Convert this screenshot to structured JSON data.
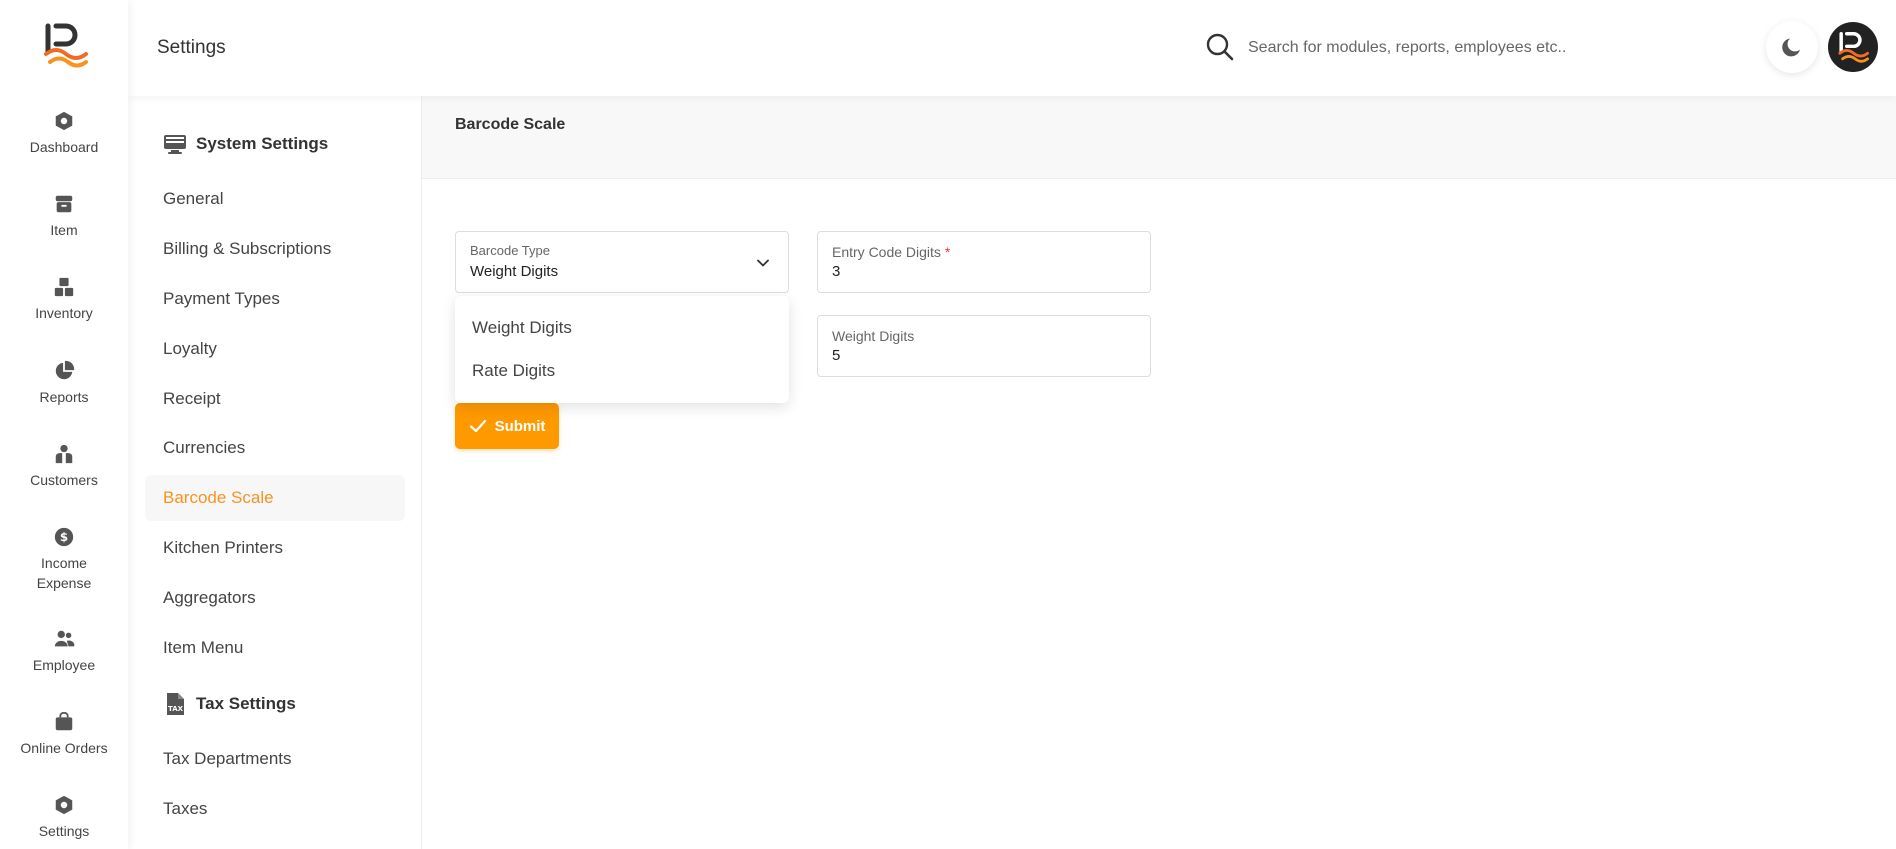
{
  "header": {
    "title": "Settings",
    "search_placeholder": "Search for modules, reports, employees etc.."
  },
  "rail": {
    "items": [
      {
        "label": "Dashboard",
        "icon": "dashboard-icon"
      },
      {
        "label": "Item",
        "icon": "archive-icon"
      },
      {
        "label": "Inventory",
        "icon": "boxes-icon"
      },
      {
        "label": "Reports",
        "icon": "pie-chart-icon"
      },
      {
        "label": "Customers",
        "icon": "customers-icon"
      },
      {
        "label": "Income",
        "label2": "Expense",
        "icon": "dollar-icon"
      },
      {
        "label": "Employee",
        "icon": "users-icon"
      },
      {
        "label": "Online Orders",
        "icon": "bag-icon"
      },
      {
        "label": "Settings",
        "icon": "settings-icon"
      }
    ]
  },
  "submenu": {
    "system_title": "System Settings",
    "system_items": [
      "General",
      "Billing & Subscriptions",
      "Payment Types",
      "Loyalty",
      "Receipt",
      "Currencies",
      "Barcode Scale",
      "Kitchen Printers",
      "Aggregators",
      "Item Menu"
    ],
    "active_item": "Barcode Scale",
    "tax_title": "Tax Settings",
    "tax_items": [
      "Tax Departments",
      "Taxes"
    ]
  },
  "main": {
    "title": "Barcode Scale",
    "barcode_type": {
      "label": "Barcode Type",
      "value": "Weight Digits"
    },
    "entry_code": {
      "label": "Entry Code Digits",
      "required_mark": "*",
      "value": "3"
    },
    "weight_digits": {
      "label": "Weight Digits",
      "value": "5"
    },
    "dropdown_options": [
      "Weight Digits",
      "Rate Digits"
    ],
    "submit_label": "Submit"
  },
  "colors": {
    "accent": "#ff9900",
    "active_text": "#f7931e",
    "required": "#e53935"
  }
}
